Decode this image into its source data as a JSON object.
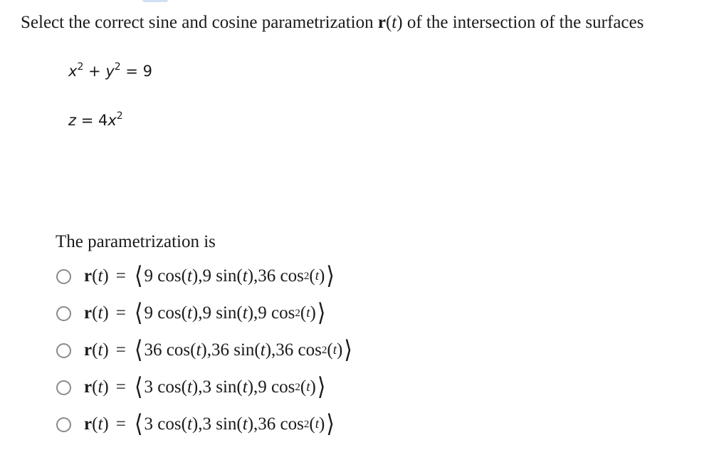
{
  "question": {
    "prefix": "Select the correct sine and cosine parametrization ",
    "r_symbol": "r",
    "paren_open": "(",
    "t_symbol": "t",
    "suffix": ") of the intersection of the surfaces"
  },
  "surfaces": {
    "eq1": {
      "a": "x",
      "plus": " + ",
      "b": "y",
      "rhs": " = 9",
      "exp": "2"
    },
    "eq2": {
      "a": "z",
      "mid": " = 4",
      "b": "x",
      "exp": "2"
    }
  },
  "param_heading": "The parametrization is",
  "options": [
    {
      "c1": "9",
      "c2": "9",
      "c3": "36"
    },
    {
      "c1": "9",
      "c2": "9",
      "c3": "9"
    },
    {
      "c1": "36",
      "c2": "36",
      "c3": "36"
    },
    {
      "c1": "3",
      "c2": "3",
      "c3": "9"
    },
    {
      "c1": "3",
      "c2": "3",
      "c3": "36"
    }
  ],
  "formula_parts": {
    "lhs_r": "r",
    "lhs_open": "(",
    "lhs_t": "t",
    "lhs_close": ")",
    "equals": "=",
    "langle": "⟨",
    "rangle": "⟩",
    "cos": "cos",
    "sin": "sin",
    "comma": ", ",
    "open": "(",
    "close": ")",
    "t": "t",
    "sq": "2"
  },
  "colors": {
    "text": "#1a1a1a",
    "radio_border": "#8a8a8a",
    "accent": "#cfe0f3"
  }
}
